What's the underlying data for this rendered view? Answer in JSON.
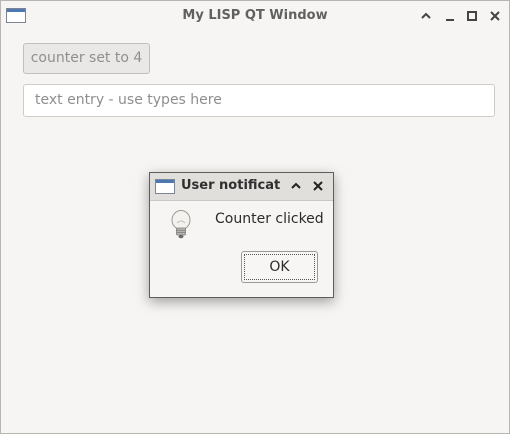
{
  "window": {
    "title": "My LISP QT Window",
    "icon": "window-icon",
    "controls": {
      "collapse": "chevron-up-icon",
      "minimize": "minimize-icon",
      "maximize": "maximize-icon",
      "close": "close-icon"
    }
  },
  "content": {
    "counter_button_label": "counter set to 4",
    "text_entry_placeholder": "text entry - use types here"
  },
  "dialog": {
    "title": "User notificati",
    "message": "Counter clicked",
    "ok_label": "OK",
    "icon": "lightbulb-icon"
  }
}
